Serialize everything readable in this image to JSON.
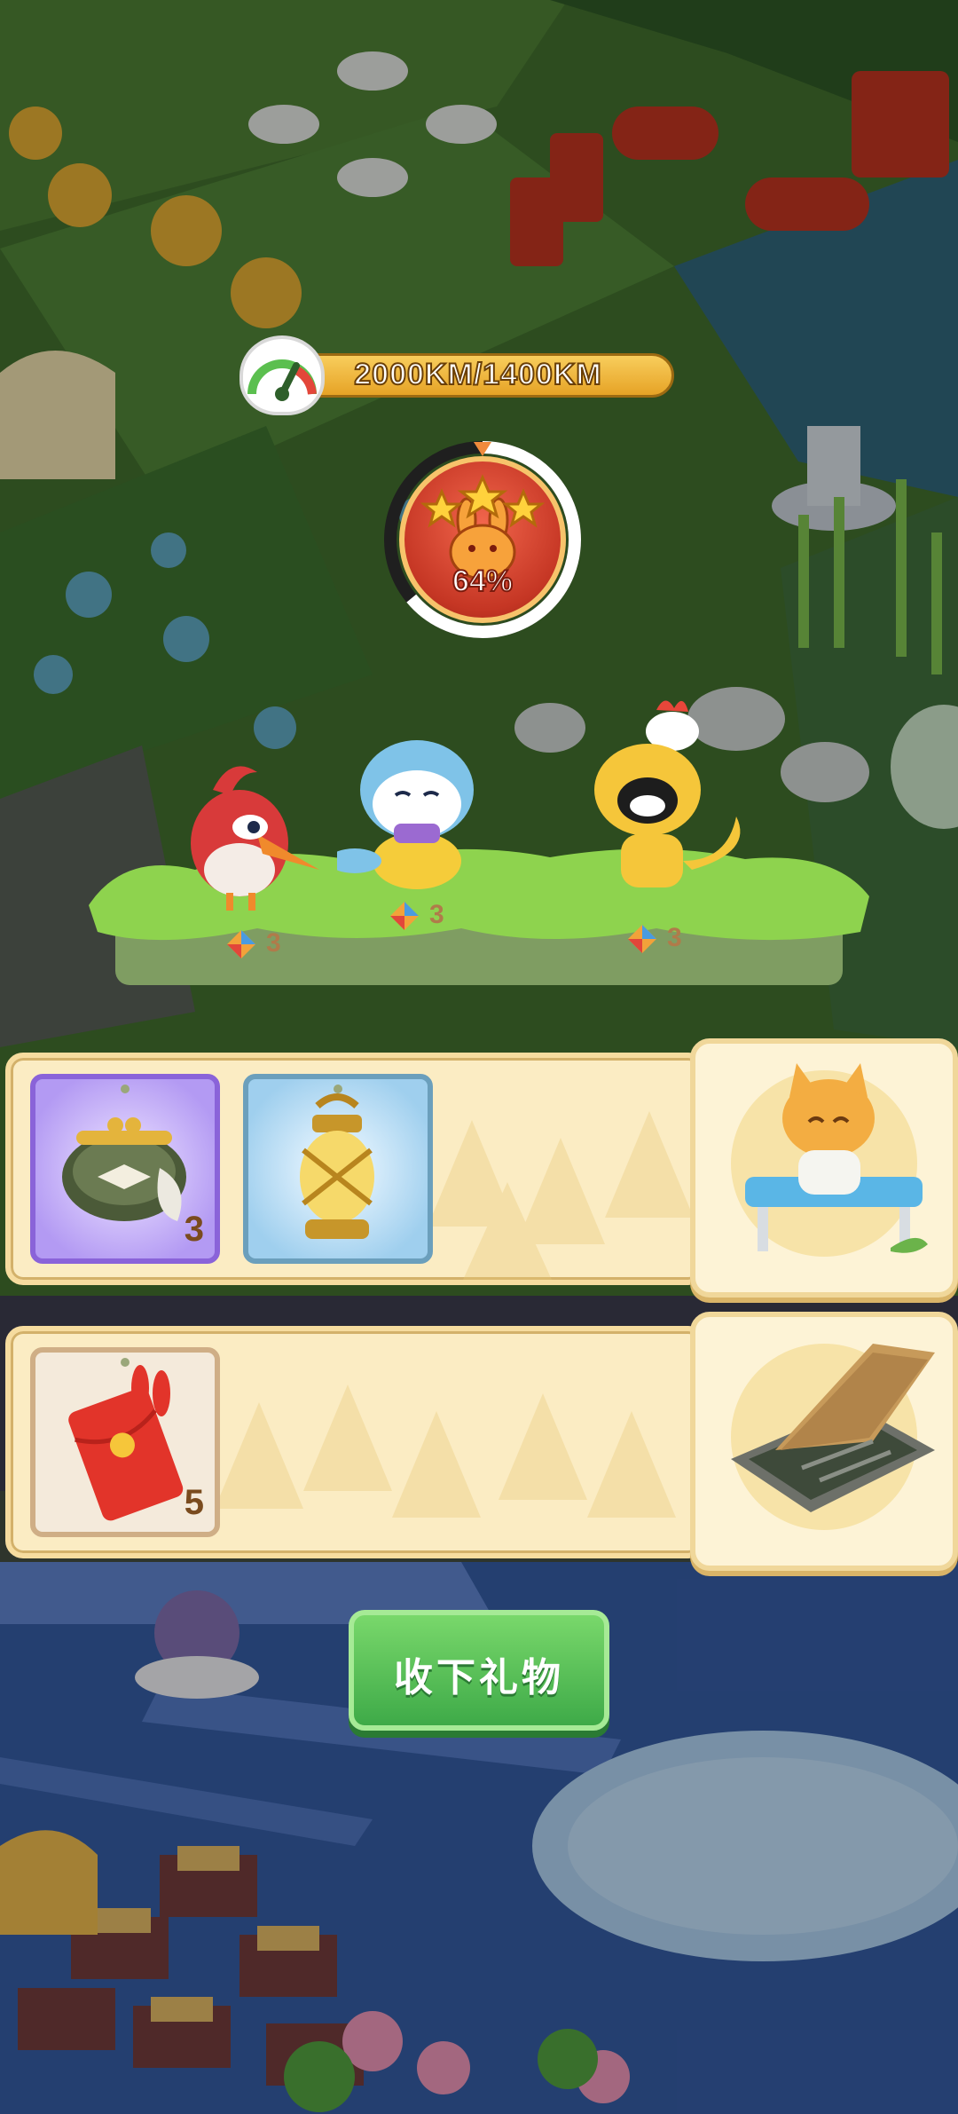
{
  "speed": {
    "text": "2000KM/1400KM"
  },
  "progress_badge": {
    "percent_text": "64%",
    "stars": 3,
    "fill_fraction": 0.64
  },
  "characters": [
    {
      "name": "red-bird",
      "gift_count": "3"
    },
    {
      "name": "blue-otter",
      "gift_count": "3"
    },
    {
      "name": "yellow-dog",
      "gift_count": "3"
    }
  ],
  "reward_rows": [
    {
      "items": [
        {
          "icon": "coin-purse-icon",
          "count": "3",
          "frame": "purple"
        },
        {
          "icon": "lantern-icon",
          "count": "",
          "frame": "blue"
        }
      ],
      "card_icon": "cat-on-bench-icon"
    },
    {
      "items": [
        {
          "icon": "red-envelope-icon",
          "count": "5",
          "frame": "beige"
        }
      ],
      "card_icon": "trapdoor-icon"
    }
  ],
  "button": {
    "accept_label": "收下礼物"
  },
  "colors": {
    "accent_green": "#4cb552",
    "panel_bg": "#fbecc3",
    "badge_red": "#c53624",
    "bar_gold": "#f0b83a"
  }
}
